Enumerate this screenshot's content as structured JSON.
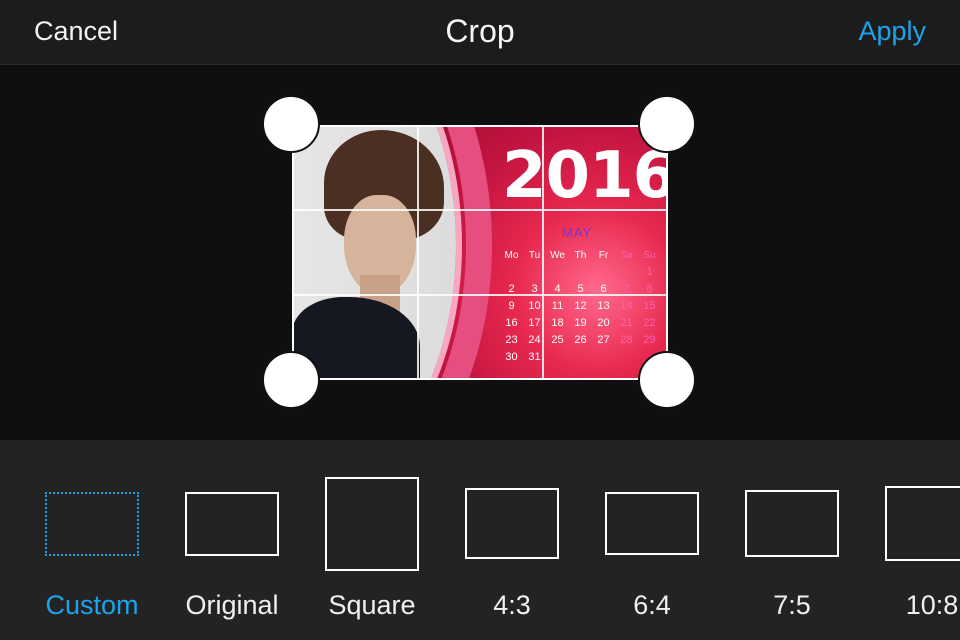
{
  "header": {
    "cancel_label": "Cancel",
    "title": "Crop",
    "apply_label": "Apply"
  },
  "photo": {
    "year": "2016",
    "month": "MAY",
    "weekdays": [
      "Mo",
      "Tu",
      "We",
      "Th",
      "Fr",
      "Sa",
      "Su"
    ],
    "weeks": [
      [
        "",
        "",
        "",
        "",
        "",
        "",
        "1"
      ],
      [
        "2",
        "3",
        "4",
        "5",
        "6",
        "7",
        "8"
      ],
      [
        "9",
        "10",
        "11",
        "12",
        "13",
        "14",
        "15"
      ],
      [
        "16",
        "17",
        "18",
        "19",
        "20",
        "21",
        "22"
      ],
      [
        "23",
        "24",
        "25",
        "26",
        "27",
        "28",
        "29"
      ],
      [
        "30",
        "31",
        "",
        "",
        "",
        "",
        ""
      ]
    ]
  },
  "aspect_ratios": [
    {
      "label": "Custom",
      "selected": true
    },
    {
      "label": "Original",
      "selected": false
    },
    {
      "label": "Square",
      "selected": false
    },
    {
      "label": "4:3",
      "selected": false
    },
    {
      "label": "6:4",
      "selected": false
    },
    {
      "label": "7:5",
      "selected": false
    },
    {
      "label": "10:8",
      "selected": false
    }
  ],
  "colors": {
    "accent": "#1ea3ea",
    "background": "#0f0f0f",
    "toolbar": "#1c1c1c",
    "bottom_bar": "#232323"
  }
}
